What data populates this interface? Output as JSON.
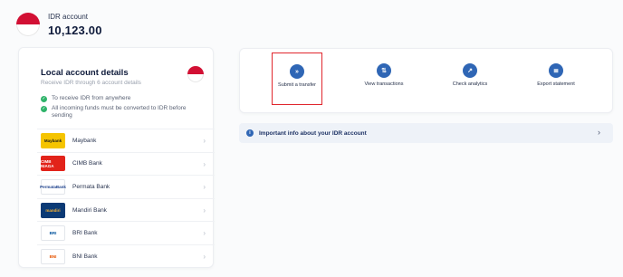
{
  "header": {
    "account_name": "IDR account",
    "balance": "10,123.00"
  },
  "local_account": {
    "title": "Local account details",
    "subtitle": "Receive IDR through 6 account details",
    "checks": [
      "To receive IDR from anywhere",
      "All incoming funds must be converted to IDR before sending"
    ],
    "banks": [
      {
        "name": "Maybank",
        "logo_text": "Maybank",
        "logo_bg": "#f5c400",
        "logo_fg": "#1a1a1a"
      },
      {
        "name": "CIMB Bank",
        "logo_text": "CIMB NIAGA",
        "logo_bg": "#e2231a",
        "logo_fg": "#ffffff"
      },
      {
        "name": "Permata Bank",
        "logo_text": "PermataBank",
        "logo_bg": "#ffffff",
        "logo_fg": "#1b3f8b"
      },
      {
        "name": "Mandiri Bank",
        "logo_text": "mandiri",
        "logo_bg": "#0b3a75",
        "logo_fg": "#f9b233"
      },
      {
        "name": "BRI Bank",
        "logo_text": "BRI",
        "logo_bg": "#ffffff",
        "logo_fg": "#00529c"
      },
      {
        "name": "BNI Bank",
        "logo_text": "BNI",
        "logo_bg": "#ffffff",
        "logo_fg": "#e55300"
      }
    ]
  },
  "actions": [
    {
      "label": "Submit a transfer",
      "icon": "double-chevron-right-icon",
      "glyph": "»",
      "selected": true
    },
    {
      "label": "View transactions",
      "icon": "swap-arrows-icon",
      "glyph": "⇅",
      "selected": false
    },
    {
      "label": "Check analytics",
      "icon": "trend-up-icon",
      "glyph": "↗",
      "selected": false
    },
    {
      "label": "Export statement",
      "icon": "document-icon",
      "glyph": "≣",
      "selected": false
    }
  ],
  "info_bar": {
    "text": "Important info about your IDR account",
    "icon_glyph": "i"
  },
  "colors": {
    "accent": "#2f66b5",
    "selection": "#e0262d",
    "check": "#2fb36a",
    "flag_red": "#d21034"
  }
}
